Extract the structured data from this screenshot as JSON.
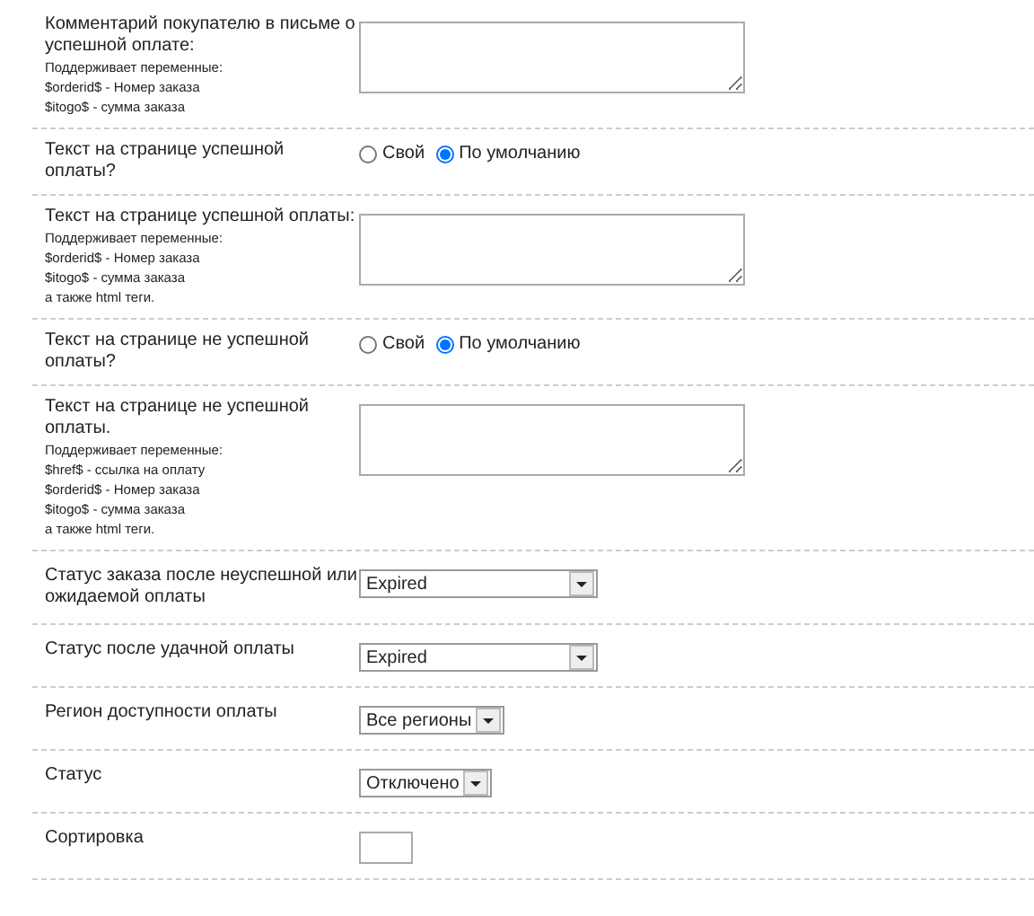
{
  "rows": [
    {
      "kind": "textarea",
      "label": "Комментарий покупателю в письме о успешной оплате:",
      "hints": [
        "Поддерживает переменные:",
        "$orderid$ - Номер заказа",
        "$itogo$ - сумма заказа"
      ]
    },
    {
      "kind": "radio",
      "label": "Текст на странице успешной оплаты?",
      "options": [
        {
          "label": "Свой",
          "selected": false
        },
        {
          "label": "По умолчанию",
          "selected": true
        }
      ]
    },
    {
      "kind": "textarea",
      "label": "Текст на странице успешной оплаты:",
      "hints": [
        "Поддерживает переменные:",
        "$orderid$ - Номер заказа",
        "$itogo$ - сумма заказа",
        "а также html теги."
      ]
    },
    {
      "kind": "radio",
      "label": "Текст на странице не успешной оплаты?",
      "options": [
        {
          "label": "Свой",
          "selected": false
        },
        {
          "label": "По умолчанию",
          "selected": true
        }
      ]
    },
    {
      "kind": "textarea",
      "label": "Текст на странице не успешной оплаты.",
      "hints": [
        "Поддерживает переменные:",
        "$href$ - ссылка на оплату",
        "$orderid$ - Номер заказа",
        "$itogo$ - сумма заказа",
        "а также html теги."
      ]
    },
    {
      "kind": "select",
      "label": "Статус заказа после неуспешной или ожидаемой оплаты",
      "value": "Expired",
      "wide": true
    },
    {
      "kind": "select",
      "label": "Статус после удачной оплаты",
      "value": "Expired",
      "wide": true
    },
    {
      "kind": "select",
      "label": "Регион доступности оплаты",
      "value": "Все регионы",
      "wide": false
    },
    {
      "kind": "select",
      "label": "Статус",
      "value": "Отключено",
      "wide": false
    },
    {
      "kind": "input",
      "label": "Сортировка"
    }
  ]
}
